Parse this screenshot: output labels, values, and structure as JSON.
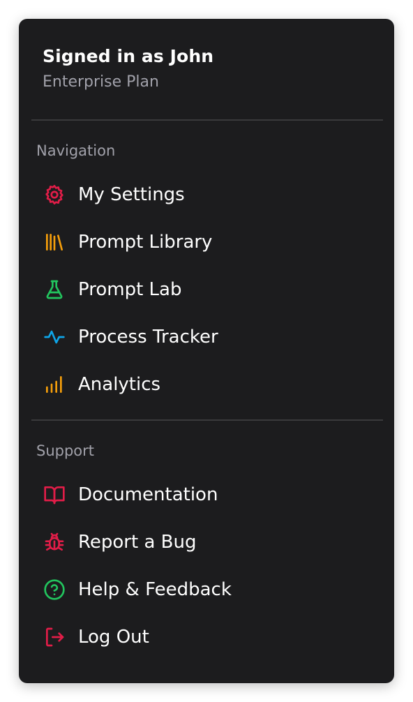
{
  "user": {
    "signed_in_text": "Signed in as John",
    "plan": "Enterprise Plan"
  },
  "navigation": {
    "section_label": "Navigation",
    "items": [
      {
        "label": "My Settings",
        "icon": "gear-icon",
        "color": "#e11d48"
      },
      {
        "label": "Prompt Library",
        "icon": "library-icon",
        "color": "#f59e0b"
      },
      {
        "label": "Prompt Lab",
        "icon": "flask-icon",
        "color": "#22c55e"
      },
      {
        "label": "Process Tracker",
        "icon": "activity-icon",
        "color": "#0ea5e9"
      },
      {
        "label": "Analytics",
        "icon": "bar-chart-icon",
        "color": "#f59e0b"
      }
    ]
  },
  "support": {
    "section_label": "Support",
    "items": [
      {
        "label": "Documentation",
        "icon": "book-open-icon",
        "color": "#e11d48"
      },
      {
        "label": "Report a Bug",
        "icon": "bug-icon",
        "color": "#e11d48"
      },
      {
        "label": "Help & Feedback",
        "icon": "help-circle-icon",
        "color": "#22c55e"
      },
      {
        "label": "Log Out",
        "icon": "log-out-icon",
        "color": "#e11d48"
      }
    ]
  }
}
